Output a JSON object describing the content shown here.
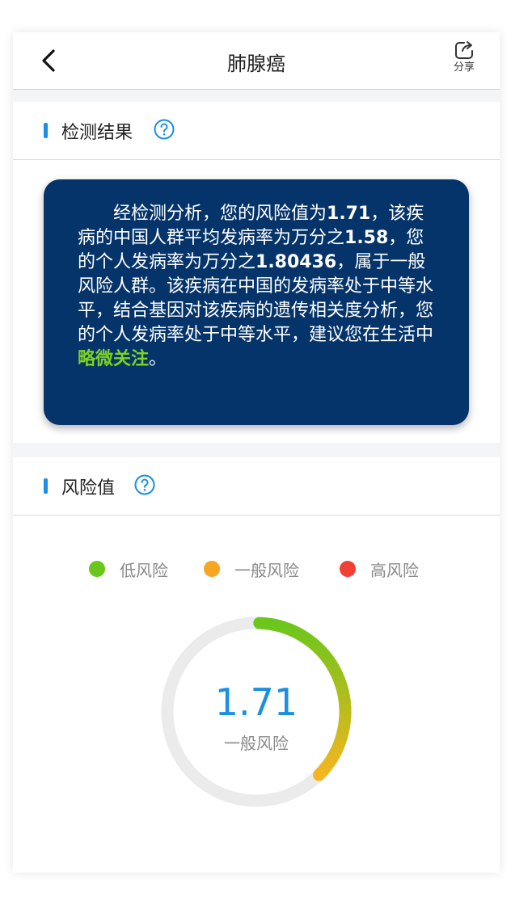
{
  "header": {
    "title": "肺腺癌",
    "share_label": "分享"
  },
  "result_section": {
    "title": "检测结果",
    "text_parts": [
      {
        "text": "经检测分析，您的风险值为",
        "style": "normal"
      },
      {
        "text": "1.71",
        "style": "bold"
      },
      {
        "text": "，该疾病的中国人群平均发病率为万分之",
        "style": "normal"
      },
      {
        "text": "1.58",
        "style": "bold"
      },
      {
        "text": "，您的个人发病率为万分之",
        "style": "normal"
      },
      {
        "text": "1.80436",
        "style": "bold"
      },
      {
        "text": "，属于一般风险人群。该疾病在中国的发病率处于中等水平，结合基因对该疾病的遗传相关度分析，您的个人发病率处于中等水平，建议您在生活中",
        "style": "normal"
      },
      {
        "text": "略微关注",
        "style": "highlight"
      },
      {
        "text": "。",
        "style": "normal"
      }
    ]
  },
  "risk_section": {
    "title": "风险值",
    "legend": [
      {
        "label": "低风险",
        "color": "#6bc61c"
      },
      {
        "label": "一般风险",
        "color": "#f5a623"
      },
      {
        "label": "高风险",
        "color": "#f04134"
      }
    ],
    "gauge": {
      "value": "1.71",
      "level": "一般风险",
      "fill_fraction": 0.37,
      "track_color": "#ebebeb",
      "gradient_start": "#6bc61c",
      "gradient_end": "#f5b51e"
    }
  }
}
